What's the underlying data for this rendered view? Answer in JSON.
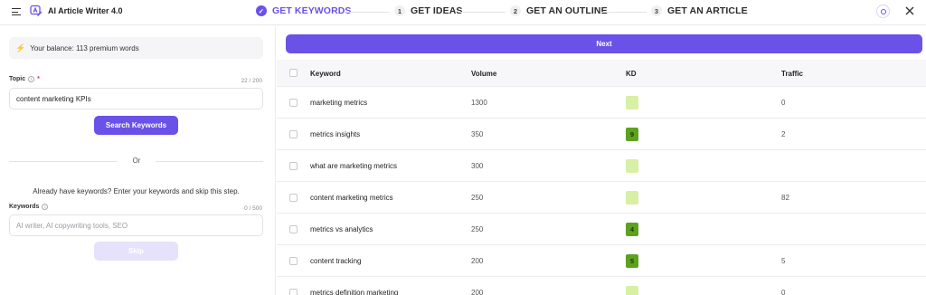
{
  "app": {
    "title": "AI Article Writer 4.0"
  },
  "steps": [
    {
      "num": "",
      "label": "GET KEYWORDS",
      "active": true
    },
    {
      "num": "1",
      "label": "GET IDEAS",
      "active": false
    },
    {
      "num": "2",
      "label": "GET AN OUTLINE",
      "active": false
    },
    {
      "num": "3",
      "label": "GET AN ARTICLE",
      "active": false
    }
  ],
  "left": {
    "balance": "Your balance: 113 premium words",
    "topic": {
      "label": "Topic",
      "required": "*",
      "counter": "22 / 200",
      "value": "content marketing KPIs"
    },
    "search_button": "Search Keywords",
    "or": "Or",
    "hint": "Already have keywords? Enter your keywords and skip this step.",
    "keywords": {
      "label": "Keywords",
      "counter": "0 / 500",
      "placeholder": "AI writer, AI copywriting tools, SEO"
    },
    "skip_button": "Skip"
  },
  "right": {
    "next_button": "Next",
    "columns": {
      "keyword": "Keyword",
      "volume": "Volume",
      "kd": "KD",
      "traffic": "Traffic"
    },
    "rows": [
      {
        "keyword": "marketing metrics",
        "volume": "1300",
        "kd": "",
        "kd_color": "#d7f0a4",
        "traffic": "0"
      },
      {
        "keyword": "metrics insights",
        "volume": "350",
        "kd": "9",
        "kd_color": "#5da21e",
        "traffic": "2"
      },
      {
        "keyword": "what are marketing metrics",
        "volume": "300",
        "kd": "",
        "kd_color": "#d7f0a4",
        "traffic": ""
      },
      {
        "keyword": "content marketing metrics",
        "volume": "250",
        "kd": "",
        "kd_color": "#d7f0a4",
        "traffic": "82"
      },
      {
        "keyword": "metrics vs analytics",
        "volume": "250",
        "kd": "4",
        "kd_color": "#5da21e",
        "traffic": ""
      },
      {
        "keyword": "content tracking",
        "volume": "200",
        "kd": "5",
        "kd_color": "#5da21e",
        "traffic": "5"
      },
      {
        "keyword": "metrics definition marketing",
        "volume": "200",
        "kd": "",
        "kd_color": "#d7f0a4",
        "traffic": "0"
      }
    ]
  }
}
